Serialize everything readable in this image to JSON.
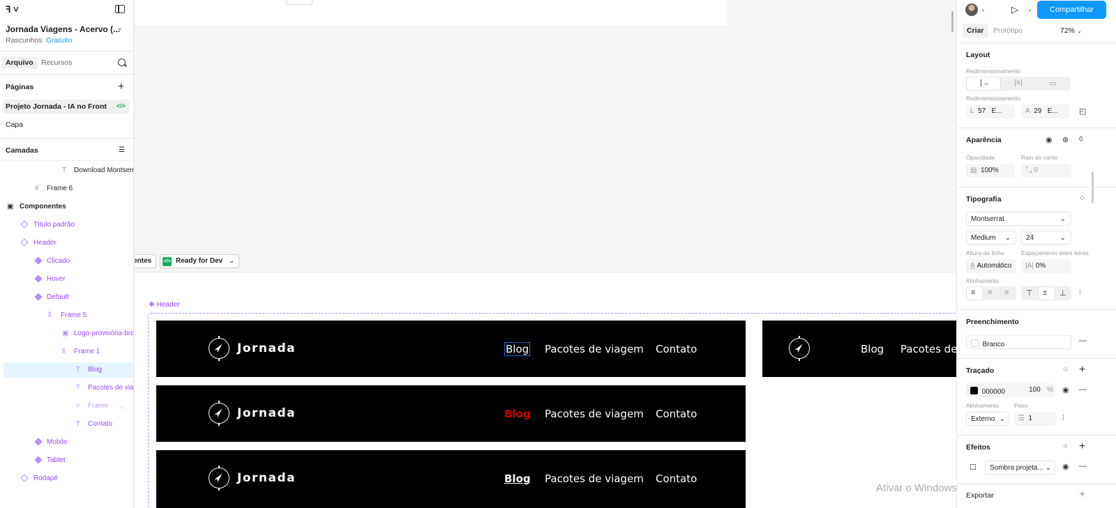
{
  "left_panel": {
    "file_title": "Jornada Viagens - Acervo (...",
    "drafts": "Rascunhos",
    "plan": "Gratuito",
    "tabs": [
      "Arquivo",
      "Recursos"
    ],
    "pages_header": "Páginas",
    "pages": [
      "Projeto Jornada - IA no Front",
      "Capa"
    ],
    "layers_header": "Camadas",
    "layers": [
      {
        "name": "Download Montserr",
        "icon": "T"
      },
      {
        "name": "Frame 6",
        "icon": "#"
      },
      {
        "name": "Componentes",
        "icon": "▣"
      },
      {
        "name": "Título padrão",
        "icon": "◇"
      },
      {
        "name": "Header",
        "icon": "◇"
      },
      {
        "name": "Clicado",
        "icon": "◆"
      },
      {
        "name": "Hover",
        "icon": "◆"
      },
      {
        "name": "Default",
        "icon": "◆"
      },
      {
        "name": "Frame 5",
        "icon": "|||"
      },
      {
        "name": "Logo-provisória-bra",
        "icon": "▣"
      },
      {
        "name": "Frame 1",
        "icon": "|||"
      },
      {
        "name": "Blog",
        "icon": "T"
      },
      {
        "name": "Pacotes de viag",
        "icon": "T"
      },
      {
        "name": "Frame",
        "icon": "#"
      },
      {
        "name": "Contato",
        "icon": "T"
      },
      {
        "name": "Mobile",
        "icon": "◆"
      },
      {
        "name": "Tablet",
        "icon": "◆"
      },
      {
        "name": "Rodapé",
        "icon": "◇"
      }
    ]
  },
  "canvas": {
    "chip_left": "nentes",
    "chip_ready": "Ready for Dev",
    "component_label": "Header",
    "brand": "Jornada",
    "nav": {
      "blog": "Blog",
      "packages": "Pacotes de viagem",
      "contact": "Contato"
    },
    "watermark": "Ativar o Windows"
  },
  "right_panel": {
    "share": "Compartilhar",
    "tabs": [
      "Criar",
      "Protótipo"
    ],
    "zoom": "72%",
    "layout": {
      "title": "Layout",
      "resize_label": "Redimensionamento",
      "resize_label2": "Redimensionamento",
      "width_letter": "L",
      "width": "57",
      "width_mode": "E...",
      "height_letter": "A",
      "height": "29",
      "height_mode": "E..."
    },
    "appearance": {
      "title": "Aparência",
      "opacity_label": "Opacidade",
      "opacity": "100%",
      "radius_label": "Raio do canto",
      "radius": "0"
    },
    "typography": {
      "title": "Tipografia",
      "font": "Montserrat",
      "weight": "Medium",
      "size": "24",
      "line_height_label": "Altura da linha",
      "line_height": "Automático",
      "letter_spacing_label": "Espaçamento entre letras",
      "letter_spacing": "0%",
      "align_label": "Alinhamento"
    },
    "fill": {
      "title": "Preenchimento",
      "value": "Branco"
    },
    "stroke": {
      "title": "Traçado",
      "hex": "000000",
      "opacity": "100",
      "pct": "%",
      "align_label": "Alinhamento",
      "weight_label": "Peso",
      "align": "Externo",
      "weight": "1"
    },
    "effects": {
      "title": "Efeitos",
      "value": "Sombra projeta..."
    },
    "export": {
      "title": "Exportar"
    }
  },
  "colors": {
    "accent": "#0d99ff",
    "component": "#9747ff",
    "dev": "#14ae5c",
    "header_bg": "#000000",
    "blog_red": "#cc0000"
  }
}
